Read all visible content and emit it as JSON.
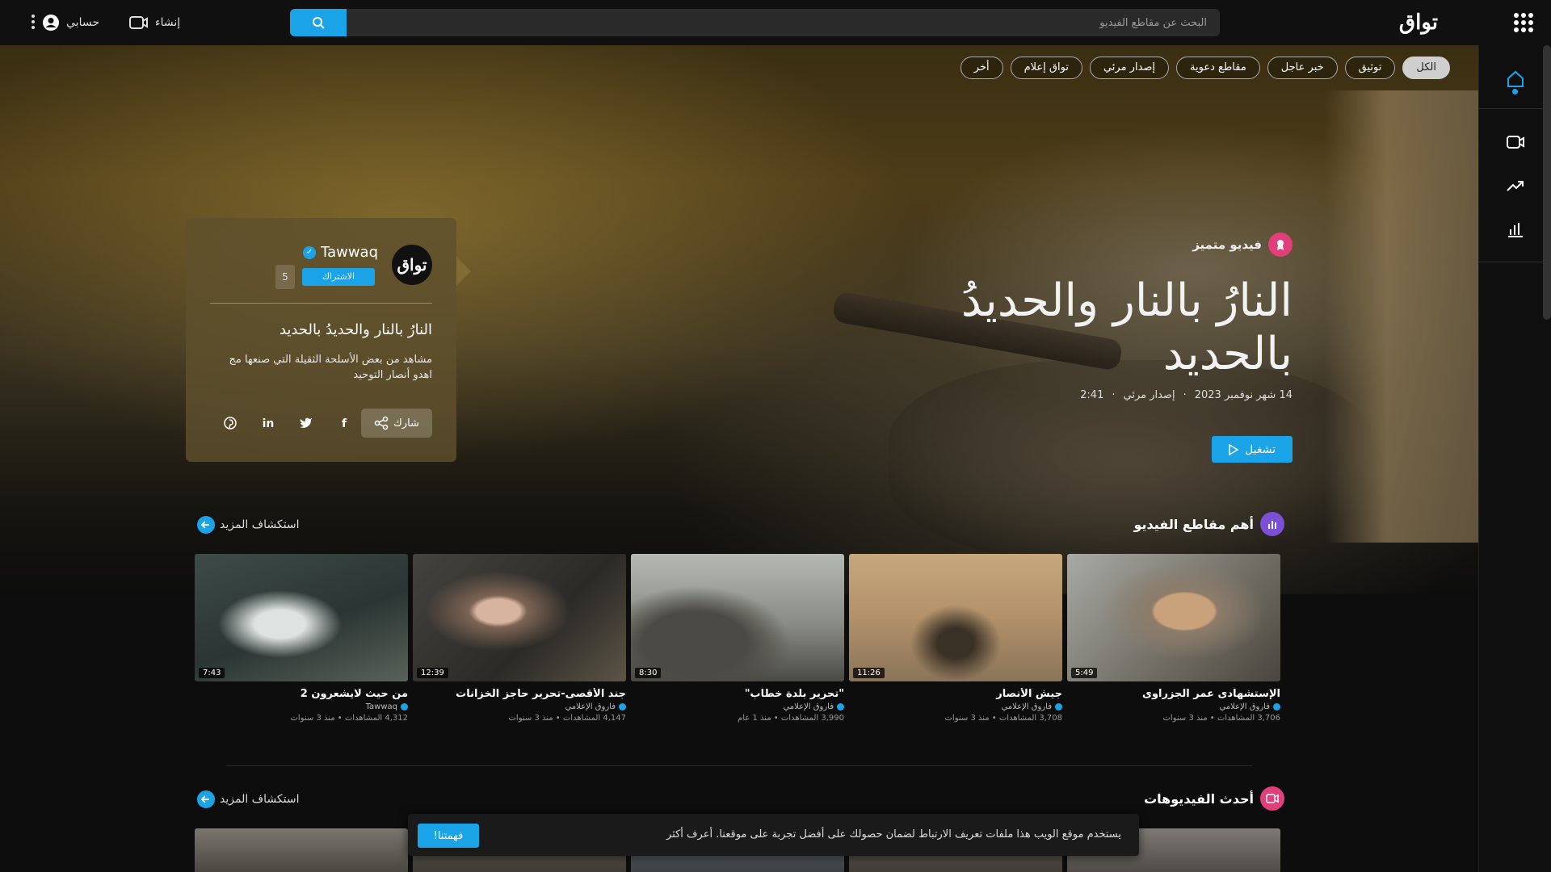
{
  "header": {
    "search_placeholder": "البحث عن مقاطع الفيديو",
    "create_label": "إنشاء",
    "account_label": "حسابي",
    "logo_text": "تواق"
  },
  "chips": [
    "الكل",
    "توثيق",
    "خبر عاجل",
    "مقاطع دعوية",
    "إصدار مرئي",
    "تواق إعلام",
    "أخر"
  ],
  "featured": {
    "badge": "فيديو متميز",
    "title": "النارُ بالنار والحديدُ بالحديد",
    "date": "14 شهر نوفمبر 2023",
    "category": "إصدار مرئي",
    "duration": "2:41",
    "play_label": "تشغيل"
  },
  "card": {
    "channel_name": "Tawwaq",
    "avatar_text": "تواق",
    "subscribe_label": "الاشتراك",
    "subscriber_count": "5",
    "title": "النارُ بالنار والحديدُ بالحديد",
    "description": "مشاهد من بعض الأسلحة الثقيلة التي صنعها مج اهدو أنصار التوحيد",
    "share_label": "شارك"
  },
  "top_videos": {
    "title": "أهم مقاطع الفيديو",
    "more_label": "استكشاف المزيد",
    "items": [
      {
        "title": "الإستشهادى عمر الجزراوى",
        "channel": "فاروق الإعلامي",
        "stats": "3,706 المشاهدات • منذ 3 سنوات",
        "duration": "5:49"
      },
      {
        "title": "جيش الأنصار",
        "channel": "فاروق الإعلامي",
        "stats": "3,708 المشاهدات • منذ 3 سنوات",
        "duration": "11:26"
      },
      {
        "title": "\"تحرير بلدة خطاب\"",
        "channel": "فاروق الإعلامي",
        "stats": "3,990 المشاهدات • منذ 1 عام",
        "duration": "8:30"
      },
      {
        "title": "جند الأقصى-تحرير حاجز الخزانات",
        "channel": "فاروق الإعلامي",
        "stats": "4,147 المشاهدات • منذ 3 سنوات",
        "duration": "12:39"
      },
      {
        "title": "من حيث لايشعرون 2",
        "channel": "Tawwaq",
        "stats": "4,312 المشاهدات • منذ 3 سنوات",
        "duration": "7:43"
      }
    ]
  },
  "latest_videos": {
    "title": "أحدث الفيديوهات",
    "more_label": "استكشاف المزيد"
  },
  "cookie": {
    "text": "يستخدم موقع الويب هذا ملفات تعريف الارتباط لضمان حصولك على أفضل تجربة على موقعنا. أعرف أكثر",
    "button": "فهمتنا!"
  },
  "colors": {
    "accent": "#1ba3e8",
    "badge_pink": "#e03f7a",
    "badge_purple": "#7b4fd6"
  }
}
